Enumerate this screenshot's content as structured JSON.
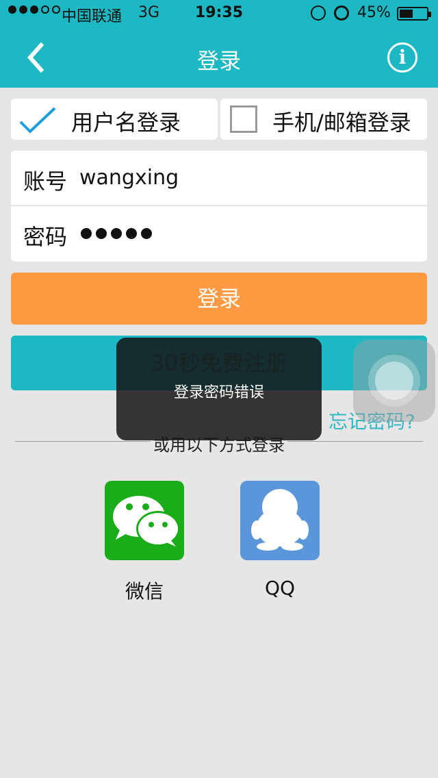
{
  "status_bar": {
    "signal_dots": [
      "filled",
      "filled",
      "filled",
      "empty",
      "empty"
    ],
    "carrier": "中国联通",
    "network": "3G",
    "time": "19:35",
    "battery_percent": "45%",
    "battery_level": 0.45
  },
  "nav": {
    "title": "登录",
    "back_icon": "chevron-left-icon",
    "info_icon": "info-icon",
    "info_glyph": "i"
  },
  "tabs": [
    {
      "label": "用户名登录",
      "selected": true
    },
    {
      "label": "手机/邮箱登录",
      "selected": false
    }
  ],
  "form": {
    "account_label": "账号",
    "account_value": "wangxing",
    "password_label": "密码",
    "password_length": 5
  },
  "buttons": {
    "login": "登录",
    "register": "30秒免费注册",
    "forgot": "忘记密码?"
  },
  "divider_text": "或用以下方式登录",
  "social": [
    {
      "label": "微信",
      "icon": "wechat-icon",
      "color": "#1aad19"
    },
    {
      "label": "QQ",
      "icon": "qq-icon",
      "color": "#5b96db"
    }
  ],
  "toast": {
    "message": "登录密码错误"
  },
  "colors": {
    "accent": "#1cb8c4",
    "login_button": "#ff9a42",
    "background": "#e6e6e6"
  }
}
